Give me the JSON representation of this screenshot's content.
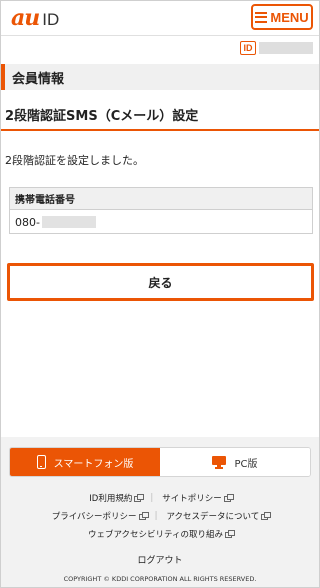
{
  "header": {
    "logo_au": "au",
    "logo_id": "ID",
    "menu_label": "MENU"
  },
  "id_badge": "ID",
  "section_title": "会員情報",
  "page_title": "2段階認証SMS（Cメール）設定",
  "message": "2段階認証を設定しました。",
  "info": {
    "header": "携帯電話番号",
    "value_prefix": "080-"
  },
  "back_button": "戻る",
  "footer": {
    "switch": {
      "smartphone": "スマートフォン版",
      "pc": "PC版"
    },
    "links_row1": [
      "ID利用規約",
      "サイトポリシー"
    ],
    "links_row2": [
      "プライバシーポリシー",
      "アクセスデータについて"
    ],
    "links_row3": [
      "ウェブアクセシビリティの取り組み"
    ],
    "logout": "ログアウト",
    "copyright": "COPYRIGHT © KDDI CORPORATION ALL RIGHTS RESERVED."
  },
  "colors": {
    "accent": "#eb5505",
    "section_bg": "#f0f0f0",
    "footer_bg": "#f2f2f2"
  },
  "icons": [
    "hamburger-icon",
    "id-icon",
    "smartphone-icon",
    "pc-monitor-icon",
    "external-link-icon"
  ]
}
